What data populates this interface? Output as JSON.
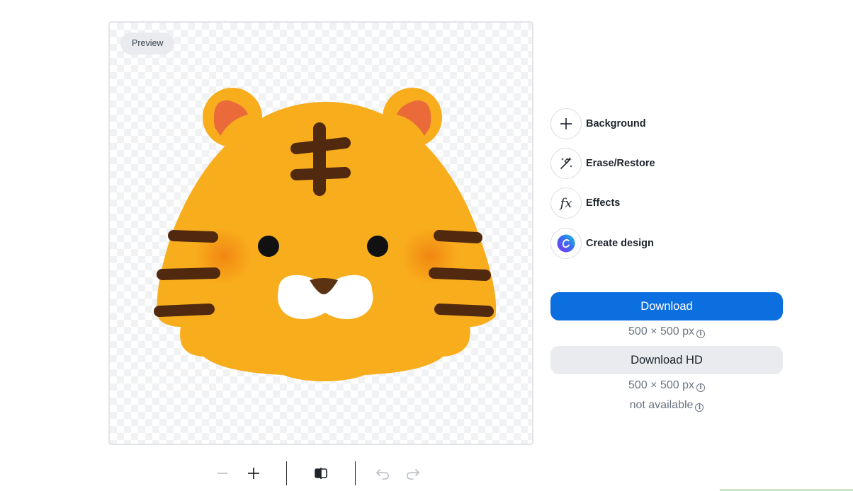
{
  "preview": {
    "label": "Preview"
  },
  "toolbar": {
    "icons": [
      "zoom-out-icon",
      "zoom-in-icon",
      "compare-icon",
      "undo-icon",
      "redo-icon"
    ]
  },
  "tools": {
    "items": [
      {
        "label": "Background",
        "icon": "plus-icon"
      },
      {
        "label": "Erase/Restore",
        "icon": "magic-wand-icon"
      },
      {
        "label": "Effects",
        "icon": "fx-icon"
      },
      {
        "label": "Create design",
        "icon": "canva-logo-icon"
      }
    ]
  },
  "download": {
    "label": "Download",
    "size": "500 × 500 px"
  },
  "download_hd": {
    "label": "Download HD",
    "size": "500 × 500 px",
    "status": "not available"
  },
  "colors": {
    "primary": "#0b6fe0",
    "secondary_bg": "#e9ebee",
    "tiger_fur": "#f8ad1c",
    "tiger_stripes": "#51290f",
    "tiger_ears": "#ea6a3a"
  }
}
